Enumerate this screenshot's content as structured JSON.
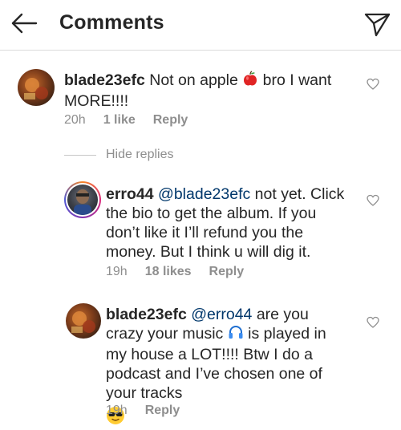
{
  "header": {
    "title": "Comments",
    "back_icon": "back-arrow-icon",
    "send_icon": "send-icon"
  },
  "comments": [
    {
      "username": "blade23efc",
      "text_before_emoji": " Not on apple ",
      "emoji": "red-apple",
      "text_after_emoji": " bro I want MORE!!!!",
      "time": "20h",
      "likes": "1 like",
      "reply": "Reply"
    }
  ],
  "hide_replies": "Hide replies",
  "replies": [
    {
      "username": "erro44",
      "mention": "@blade23efc",
      "text": " not yet. Click the bio to get the album.  If you don’t like it I’ll refund you the money.  But I think u will dig it.",
      "time": "19h",
      "likes": "18 likes",
      "reply": "Reply"
    },
    {
      "username": "blade23efc",
      "mention": "@erro44",
      "text_line1": " are you crazy",
      "text_before_emoji": "your music ",
      "emoji": "headphones",
      "text_after_emoji": " is played in my house a LOT!!!! Btw I do a podcast and I’ve chosen one of your tracks",
      "emoji2": "sunglasses-face",
      "time": "19h",
      "reply": "Reply"
    }
  ],
  "colors": {
    "text": "#262626",
    "meta": "#8e8e8e",
    "mention": "#00376b",
    "divider": "#dbdbdb"
  }
}
